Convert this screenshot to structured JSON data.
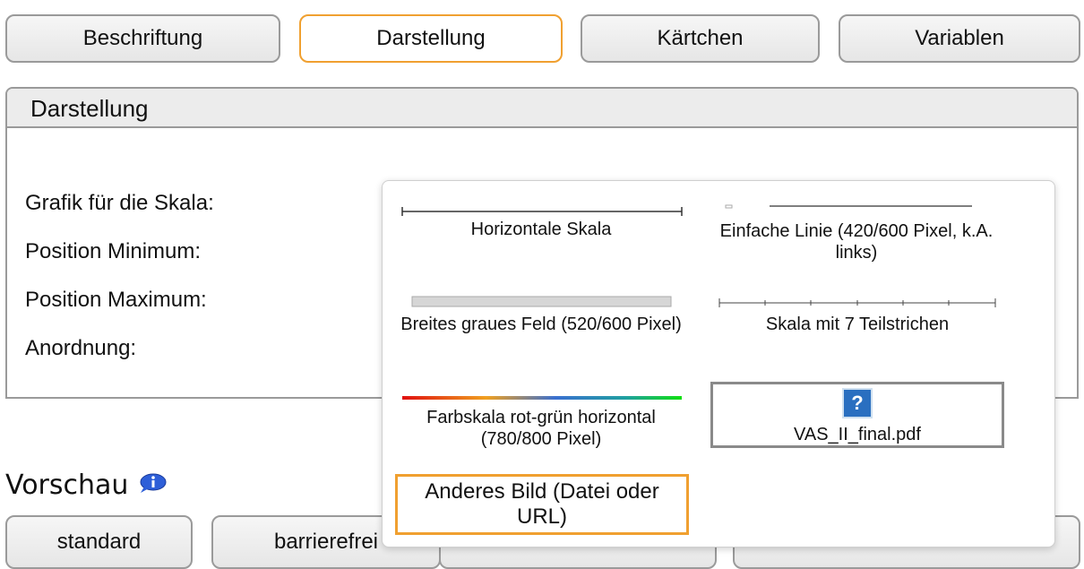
{
  "tabs": [
    {
      "label": "Beschriftung"
    },
    {
      "label": "Darstellung"
    },
    {
      "label": "Kärtchen"
    },
    {
      "label": "Variablen"
    }
  ],
  "panel": {
    "title": "Darstellung",
    "fields": [
      {
        "label": "Grafik für die Skala:"
      },
      {
        "label": "Position Minimum:"
      },
      {
        "label": "Position Maximum:"
      },
      {
        "label": "Anordnung:"
      }
    ]
  },
  "preview": {
    "title": "Vorschau",
    "icon": "info-icon",
    "tabs": [
      {
        "label": "standard"
      },
      {
        "label": "barrierefrei"
      }
    ]
  },
  "popup": {
    "options": [
      {
        "label": "Horizontale Skala"
      },
      {
        "label": "Einfache Linie (420/600 Pixel, k.A. links)"
      },
      {
        "label": "Breites graues Feld (520/600 Pixel)"
      },
      {
        "label": "Skala mit 7 Teilstrichen"
      },
      {
        "label": "Farbskala rot-grün horizontal (780/800 Pixel)"
      },
      {
        "label": "VAS_II_final.pdf",
        "icon": "question-icon"
      }
    ],
    "other_label": "Anderes Bild (Datei oder URL)"
  },
  "colors": {
    "accent": "#f0a030",
    "border": "#9a9a9a",
    "question_icon": "#2a6fc0"
  }
}
